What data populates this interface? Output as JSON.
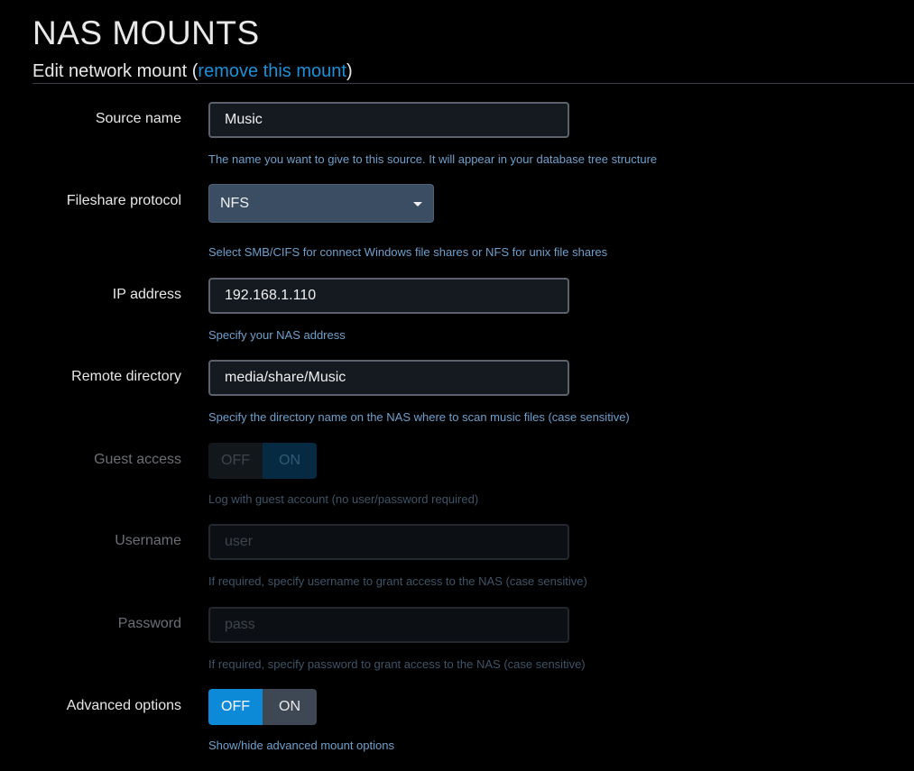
{
  "page": {
    "title": "NAS MOUNTS"
  },
  "section": {
    "title_prefix": "Edit network mount (",
    "remove_link": "remove this mount",
    "title_suffix": ")"
  },
  "form": {
    "source_name": {
      "label": "Source name",
      "value": "Music",
      "help": "The name you want to give to this source. It will appear in your database tree structure"
    },
    "protocol": {
      "label": "Fileshare protocol",
      "selected": "NFS",
      "help": "Select SMB/CIFS for connect Windows file shares or NFS for unix file shares"
    },
    "ip_address": {
      "label": "IP address",
      "value": "192.168.1.110",
      "help": "Specify your NAS address"
    },
    "remote_directory": {
      "label": "Remote directory",
      "value": "media/share/Music",
      "help": "Specify the directory name on the NAS where to scan music files (case sensitive)"
    },
    "guest_access": {
      "label": "Guest access",
      "off_label": "OFF",
      "on_label": "ON",
      "state": "ON",
      "help": "Log with guest account (no user/password required)"
    },
    "username": {
      "label": "Username",
      "placeholder": "user",
      "help": "If required, specify username to grant access to the NAS (case sensitive)"
    },
    "password": {
      "label": "Password",
      "placeholder": "pass",
      "help": "If required, specify password to grant access to the NAS (case sensitive)"
    },
    "advanced_options": {
      "label": "Advanced options",
      "off_label": "OFF",
      "on_label": "ON",
      "state": "OFF",
      "help": "Show/hide advanced mount options"
    }
  },
  "colors": {
    "accent": "#0c8ad8",
    "link": "#1e90d8",
    "help_text": "#6ea0cc"
  }
}
